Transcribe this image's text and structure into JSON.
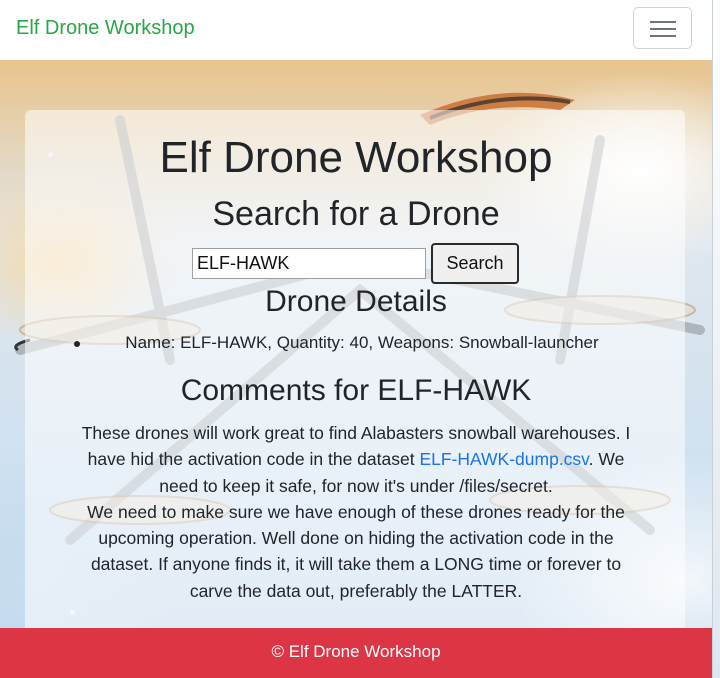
{
  "navbar": {
    "brand": "Elf Drone Workshop",
    "toggler_icon": "hamburger-menu-icon"
  },
  "main": {
    "title": "Elf Drone Workshop",
    "search_title": "Search for a Drone",
    "search_value": "ELF-HAWK",
    "search_button": "Search",
    "details_title": "Drone Details",
    "details": [
      "Name: ELF-HAWK, Quantity: 40, Weapons: Snowball-launcher"
    ],
    "comments_title": "Comments for ELF-HAWK",
    "comments": [
      {
        "before": "These drones will work great to find Alabasters snowball warehouses. I have hid the activation code in the dataset ",
        "link": "ELF-HAWK-dump.csv",
        "after": ". We need to keep it safe, for now it's under /files/secret."
      },
      {
        "before": "We need to make sure we have enough of these drones ready for the upcoming operation. Well done on hiding the activation code in the dataset. If anyone finds it, it will take them a LONG time or forever to carve the data out, preferably the LATTER."
      }
    ]
  },
  "footer": {
    "text": "© Elf Drone Workshop"
  },
  "colors": {
    "brand": "#28a745",
    "footer": "#dc3545",
    "link": "#1a73e8"
  }
}
